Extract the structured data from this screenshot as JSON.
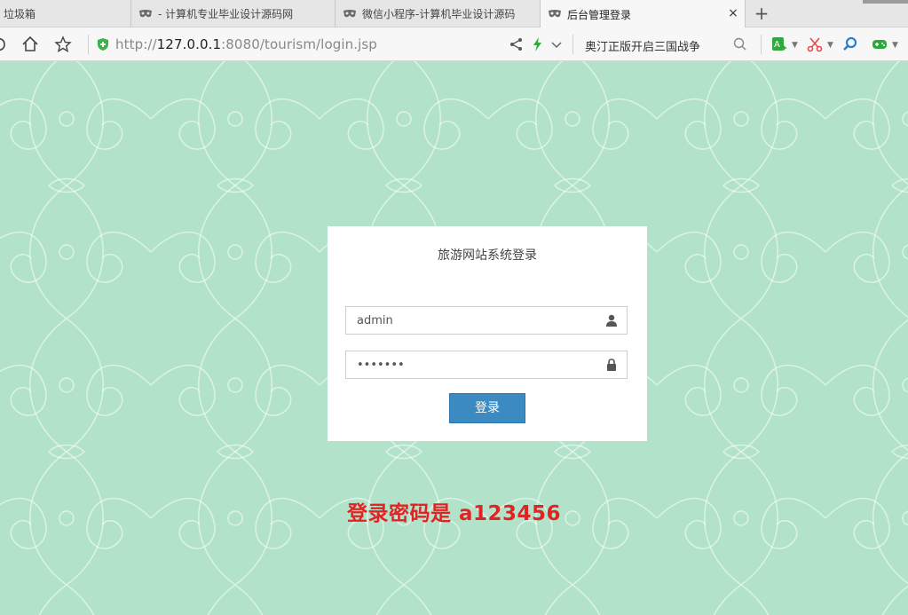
{
  "browser": {
    "tabs": [
      {
        "label": "垃圾箱",
        "active": false
      },
      {
        "label": "- 计算机专业毕业设计源码网",
        "active": false
      },
      {
        "label": "微信小程序-计算机毕业设计源码",
        "active": false
      },
      {
        "label": "后台管理登录",
        "active": true
      }
    ],
    "new_tab_label": "+",
    "close_label": "×",
    "address": {
      "protocol": "http://",
      "host": "127.0.0.1",
      "path": ":8080/tourism/login.jsp"
    },
    "search_text": "奥汀正版开启三国战争",
    "icons": [
      "back-icon",
      "home-icon",
      "star-icon",
      "secure-shield-icon",
      "share-icon",
      "lightning-icon",
      "chevron-down-icon",
      "search-icon",
      "translate-icon",
      "scissors-icon",
      "magnifier-icon",
      "gamepad-icon"
    ],
    "accent_colors": {
      "secure": "#3cb34a",
      "lightning": "#2eaa3d",
      "scissors": "#e84a4a",
      "magnifier": "#2b7fd0",
      "translate": "#2eaa3d",
      "gamepad": "#2eaa3d"
    }
  },
  "login": {
    "title": "旅游网站系统登录",
    "username_value": "admin",
    "password_value": "•••••••",
    "submit_label": "登录",
    "username_icon": "user-icon",
    "password_icon": "lock-icon"
  },
  "notice": "登录密码是 a123456",
  "colors": {
    "background": "#b2e3ca",
    "button": "#3b8ac1",
    "notice": "#e02424"
  }
}
